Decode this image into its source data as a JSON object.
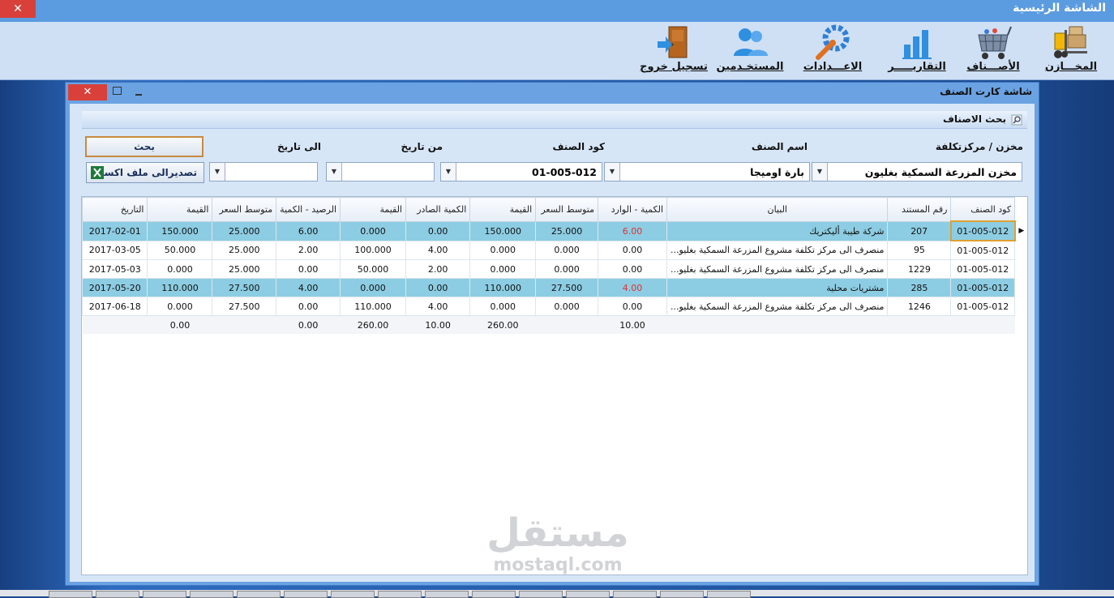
{
  "app": {
    "title": "الشاشة الرئيسية",
    "close_glyph": "✕"
  },
  "toolbar": {
    "items": [
      {
        "label": "المخـــازن",
        "icon": "forklift-icon"
      },
      {
        "label": "الأصـــناف",
        "icon": "basket-icon"
      },
      {
        "label": "التقاريـــــر",
        "icon": "bar-chart-icon"
      },
      {
        "label": "الاعـــدادات",
        "icon": "gears-icon"
      },
      {
        "label": "المستخـدمين",
        "icon": "users-icon"
      },
      {
        "label": "تسجيل خروج",
        "icon": "exit-door-icon"
      }
    ]
  },
  "window": {
    "title": "شاشة كارت الصنف",
    "close_glyph": "✕",
    "search": {
      "title": "بحث الاصناف",
      "labels": {
        "warehouse": "مخزن / مركزتكلفة",
        "item_name": "اسم الصنف",
        "item_code": "كود الصنف",
        "from_date": "من تاريخ",
        "to_date": "الى تاريخ"
      },
      "values": {
        "warehouse": "مخزن المزرعة السمكية بغليون",
        "item_name": "بارة اوميجا",
        "item_code": "01-005-012",
        "from_date": "",
        "to_date": ""
      },
      "search_button": "بحث",
      "export_button": "تصديرالى ملف اكسيل"
    },
    "grid": {
      "columns": [
        "كود الصنف",
        "رقم المستند",
        "البيان",
        "الكمية - الوارد",
        "متوسط السعر",
        "القيمة",
        "الكمية الصادر",
        "القيمة",
        "الرصيد - الكمية",
        "متوسط السعر",
        "القيمة",
        "التاريخ"
      ],
      "rows": [
        {
          "code": "01-005-012",
          "doc": "207",
          "desc": "شركة طيبة أليكتريك",
          "in_qty": "6.00",
          "in_avg": "25.000",
          "in_val": "150.000",
          "out_qty": "0.00",
          "out_val": "0.000",
          "bal_qty": "6.00",
          "bal_avg": "25.000",
          "bal_val": "150.000",
          "date": "2017-02-01",
          "selected": true,
          "red": true,
          "current": true
        },
        {
          "code": "01-005-012",
          "doc": "95",
          "desc": "منصرف الى  مركز تكلفة مشروع المزرعة السمكية بغليو...",
          "in_qty": "0.00",
          "in_avg": "0.000",
          "in_val": "0.000",
          "out_qty": "4.00",
          "out_val": "100.000",
          "bal_qty": "2.00",
          "bal_avg": "25.000",
          "bal_val": "50.000",
          "date": "2017-03-05",
          "selected": false,
          "red": false,
          "current": false
        },
        {
          "code": "01-005-012",
          "doc": "1229",
          "desc": "منصرف الى  مركز تكلفة مشروع المزرعة السمكية بغليو...",
          "in_qty": "0.00",
          "in_avg": "0.000",
          "in_val": "0.000",
          "out_qty": "2.00",
          "out_val": "50.000",
          "bal_qty": "0.00",
          "bal_avg": "25.000",
          "bal_val": "0.000",
          "date": "2017-05-03",
          "selected": false,
          "red": false,
          "current": false
        },
        {
          "code": "01-005-012",
          "doc": "285",
          "desc": "مشتريات محلية",
          "in_qty": "4.00",
          "in_avg": "27.500",
          "in_val": "110.000",
          "out_qty": "0.00",
          "out_val": "0.000",
          "bal_qty": "4.00",
          "bal_avg": "27.500",
          "bal_val": "110.000",
          "date": "2017-05-20",
          "selected": true,
          "red": true,
          "current": false
        },
        {
          "code": "01-005-012",
          "doc": "1246",
          "desc": "منصرف الى  مركز تكلفة مشروع المزرعة السمكية بغليو...",
          "in_qty": "0.00",
          "in_avg": "0.000",
          "in_val": "0.000",
          "out_qty": "4.00",
          "out_val": "110.000",
          "bal_qty": "0.00",
          "bal_avg": "27.500",
          "bal_val": "0.000",
          "date": "2017-06-18",
          "selected": false,
          "red": false,
          "current": false
        }
      ],
      "totals": {
        "in_qty": "10.00",
        "in_val": "260.00",
        "out_qty": "10.00",
        "out_val": "260.00",
        "bal_qty": "0.00",
        "bal_val": "0.00"
      }
    }
  },
  "watermark": {
    "arabic": "مستقل",
    "latin": "mostaql.com"
  },
  "colors": {
    "title_bar": "#5b9be0",
    "selected_row": "#8dcde3",
    "red_value": "#e03030",
    "close_button": "#d9403a"
  }
}
